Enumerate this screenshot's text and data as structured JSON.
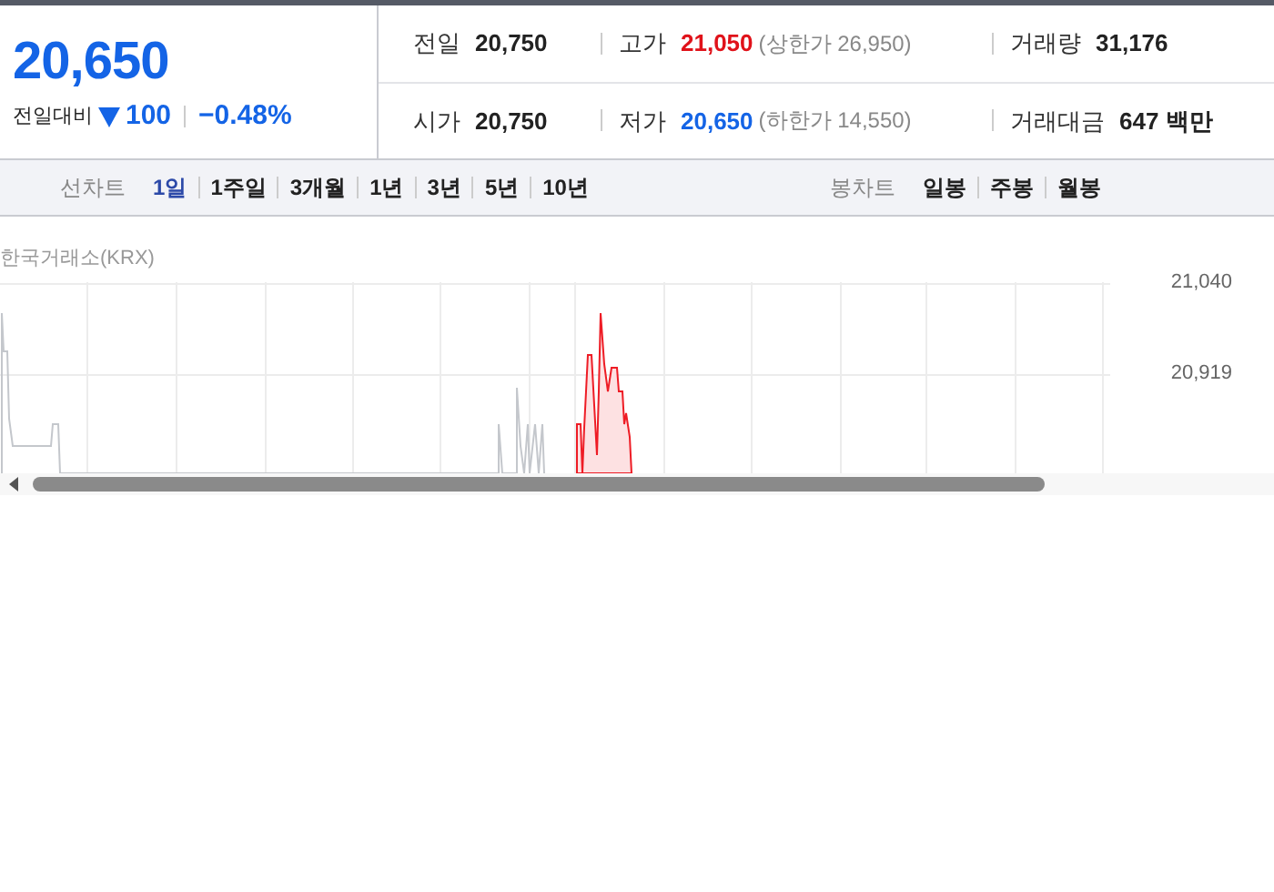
{
  "quote": {
    "price": "20,650",
    "change_label": "전일대비",
    "falling": true,
    "change": "100",
    "change_rate": "−0.48%"
  },
  "stats": [
    [
      {
        "label": "전일",
        "value": "20,750",
        "color": "#222222"
      },
      {
        "label": "고가",
        "value": "21,050",
        "color": "#e0121a",
        "limit": "(상한가 26,950)"
      },
      {
        "label": "거래량",
        "value": "31,176",
        "color": "#222222"
      }
    ],
    [
      {
        "label": "시가",
        "value": "20,750",
        "color": "#222222"
      },
      {
        "label": "저가",
        "value": "20,650",
        "color": "#1464e6",
        "limit": "(하한가 14,550)"
      },
      {
        "label": "거래대금",
        "value": "647 백만",
        "color": "#222222"
      }
    ]
  ],
  "period_tabs": {
    "label": "선차트",
    "items": [
      {
        "label": "1일",
        "selected": true
      },
      {
        "label": "1주일",
        "selected": false
      },
      {
        "label": "3개월",
        "selected": false
      },
      {
        "label": "1년",
        "selected": false
      },
      {
        "label": "3년",
        "selected": false
      },
      {
        "label": "5년",
        "selected": false
      },
      {
        "label": "10년",
        "selected": false
      }
    ]
  },
  "candle_tabs": {
    "label": "봉차트",
    "items": [
      {
        "label": "일봉",
        "selected": false
      },
      {
        "label": "주봉",
        "selected": false
      },
      {
        "label": "월봉",
        "selected": false
      }
    ]
  },
  "chart": {
    "source": "한국거래소(KRX)",
    "y_tick_labels": [
      "21,040",
      "20,919"
    ]
  }
}
